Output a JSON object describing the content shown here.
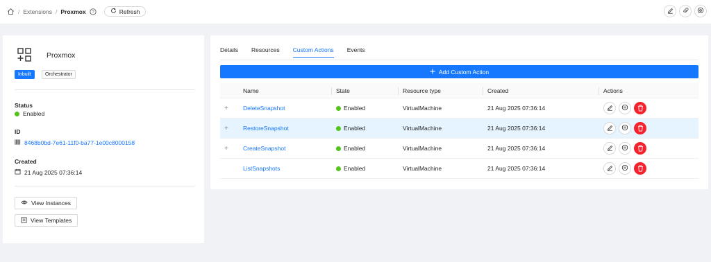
{
  "breadcrumb": {
    "sep1": "/",
    "extensions": "Extensions",
    "sep2": "/",
    "current": "Proxmox",
    "refresh_label": "Refresh"
  },
  "top_actions": [
    "edit-icon",
    "attach-icon",
    "settings-icon"
  ],
  "details": {
    "title": "Proxmox",
    "tags": [
      "Inbuilt",
      "Orchestrator"
    ],
    "status_label": "Status",
    "status_value": "Enabled",
    "id_label": "ID",
    "id_value": "8468b0bd-7e61-11f0-ba77-1e00c8000158",
    "created_label": "Created",
    "created_value": "21 Aug 2025 07:36:14",
    "view_instances": "View Instances",
    "view_templates": "View Templates"
  },
  "tabs": [
    {
      "label": "Details",
      "active": false
    },
    {
      "label": "Resources",
      "active": false
    },
    {
      "label": "Custom Actions",
      "active": true
    },
    {
      "label": "Events",
      "active": false
    }
  ],
  "add_button": "Add Custom Action",
  "table": {
    "columns": [
      "Name",
      "State",
      "Resource type",
      "Created",
      "Actions"
    ],
    "rows": [
      {
        "expand": "+",
        "name": "DeleteSnapshot",
        "state": "Enabled",
        "resource_type": "VirtualMachine",
        "created": "21 Aug 2025 07:36:14"
      },
      {
        "expand": "+",
        "name": "RestoreSnapshot",
        "state": "Enabled",
        "resource_type": "VirtualMachine",
        "created": "21 Aug 2025 07:36:14"
      },
      {
        "expand": "+",
        "name": "CreateSnapshot",
        "state": "Enabled",
        "resource_type": "VirtualMachine",
        "created": "21 Aug 2025 07:36:14"
      },
      {
        "expand": "",
        "name": "ListSnapshots",
        "state": "Enabled",
        "resource_type": "VirtualMachine",
        "created": "21 Aug 2025 07:36:14"
      }
    ]
  },
  "colors": {
    "primary": "#1677ff",
    "success": "#52c41a",
    "danger": "#f5222d",
    "row_highlight": "#e6f4ff"
  }
}
